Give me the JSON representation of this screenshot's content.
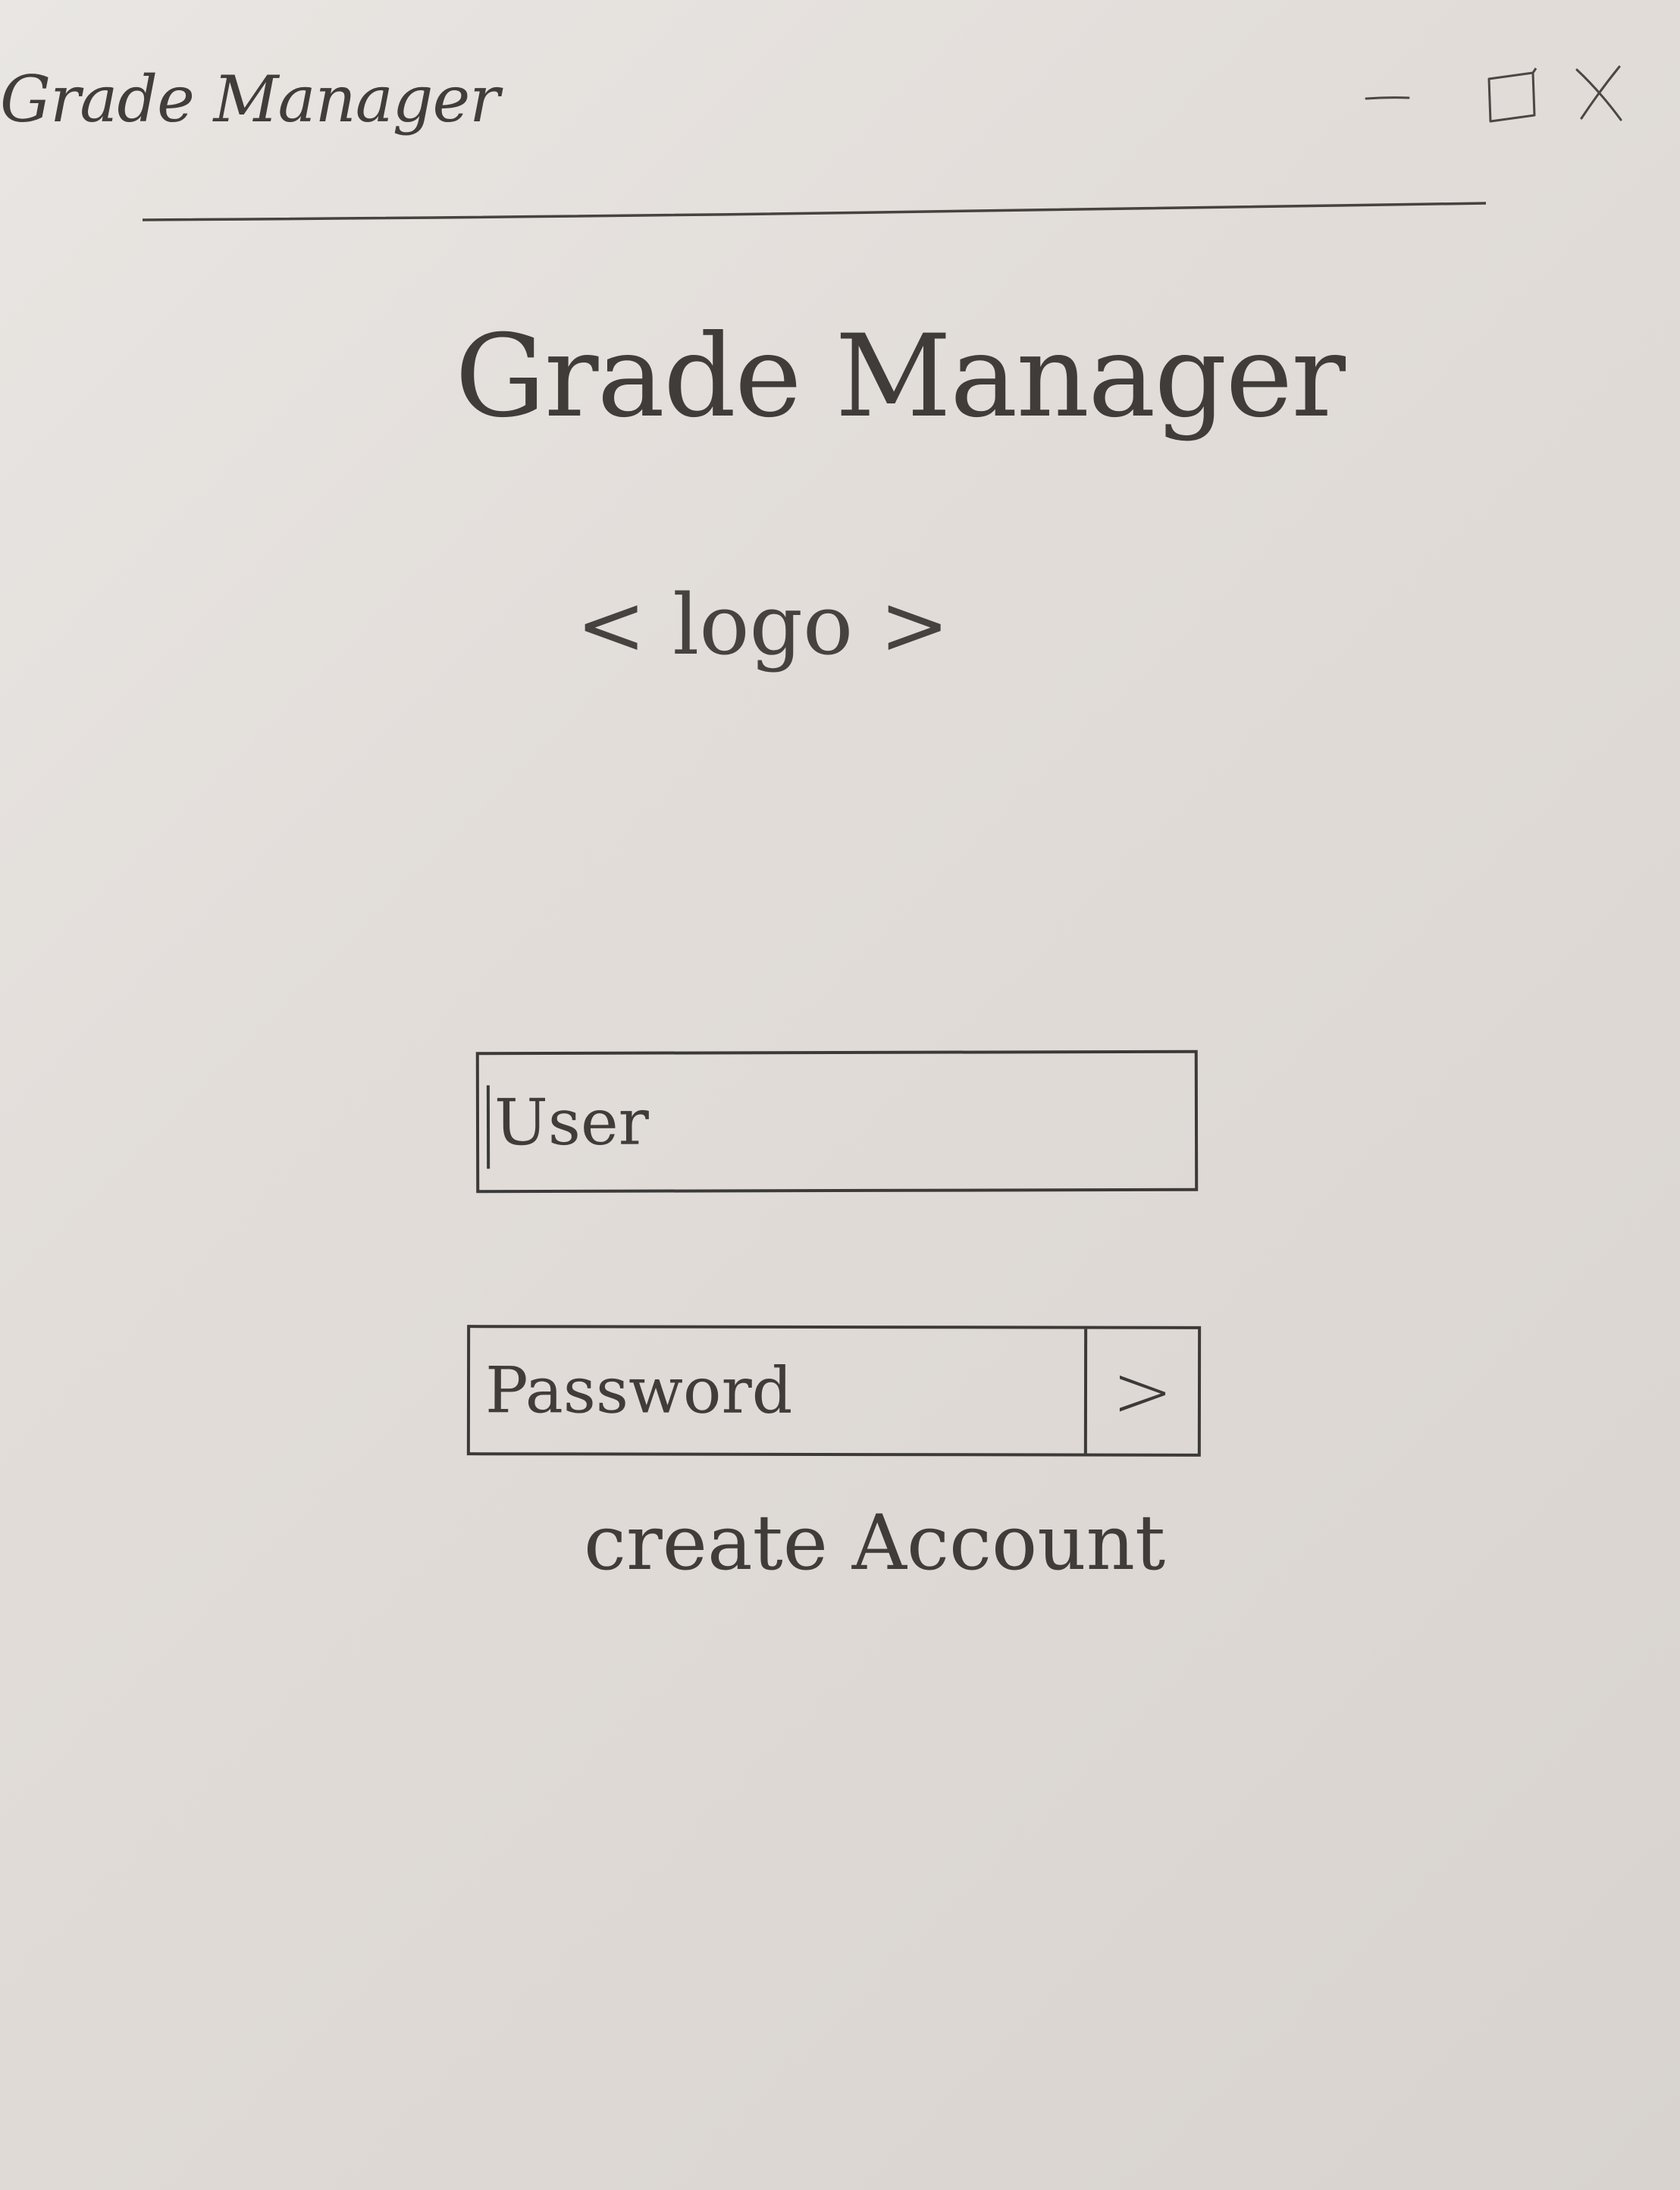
{
  "window": {
    "title": "Grade Manager"
  },
  "controls": {
    "minimize": "—",
    "maximize": "☐",
    "close": "X"
  },
  "main": {
    "title": "Grade Manager",
    "logo_placeholder": "< logo >"
  },
  "login": {
    "user_placeholder": "User",
    "password_placeholder": "Password",
    "submit_label": ">",
    "create_account_label": "create Account"
  },
  "colors": {
    "paper": "#e2ddd9",
    "ink": "#3c3a38"
  }
}
